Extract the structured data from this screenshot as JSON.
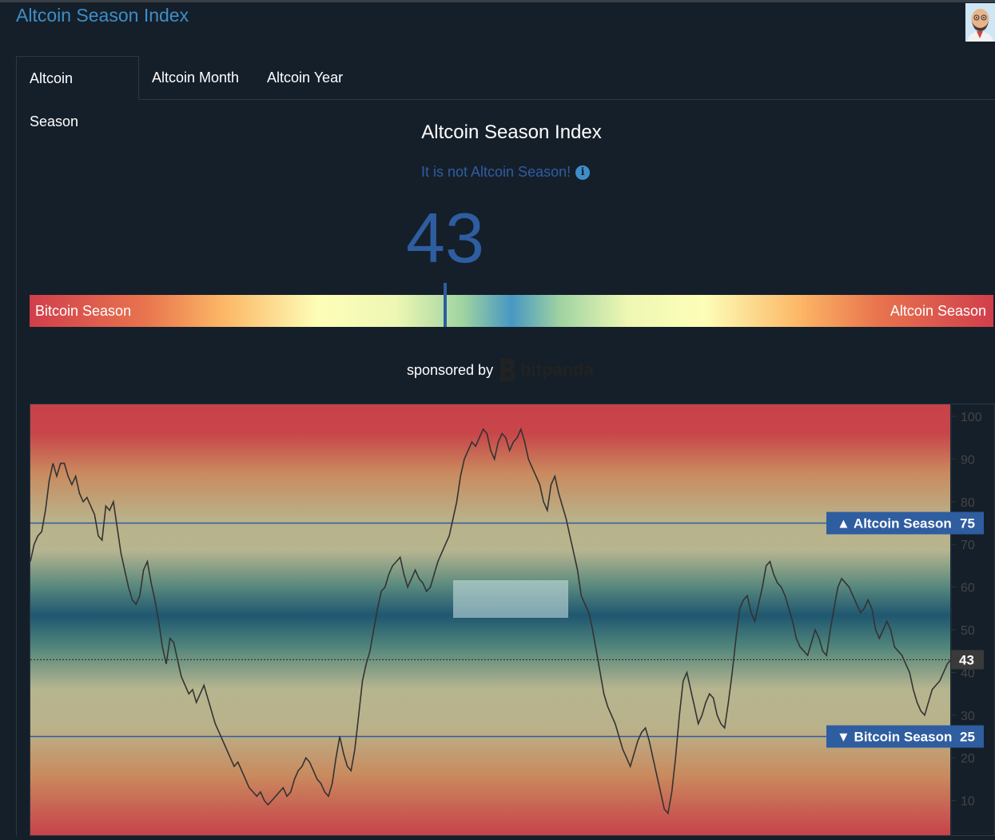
{
  "header": {
    "title": "Altcoin Season Index"
  },
  "tabs": [
    {
      "label": "Altcoin Season",
      "active": true
    },
    {
      "label": "Altcoin Month",
      "active": false
    },
    {
      "label": "Altcoin Year",
      "active": false
    }
  ],
  "index": {
    "title": "Altcoin Season Index",
    "status": "It is not Altcoin Season!",
    "value": "43"
  },
  "gauge": {
    "left_label": "Bitcoin Season",
    "right_label": "Altcoin Season",
    "value_fraction": 0.43
  },
  "sponsor": {
    "text": "sponsored by",
    "brand": "bitpanda"
  },
  "colors": {
    "accent": "#3d8ec8",
    "value_blue": "#2e5da0",
    "bitcoin_red": "#d13e4c",
    "badge_blue": "#2e5da0",
    "current_badge": "#3a3a3a"
  },
  "chart_data": {
    "type": "line",
    "ylim": [
      0,
      100
    ],
    "y_ticks": [
      10,
      20,
      30,
      40,
      50,
      60,
      70,
      80,
      90,
      100
    ],
    "current_value": 43,
    "current_label": "43",
    "thresholds": [
      {
        "label": "▲ Altcoin Season",
        "value": 75,
        "value_label": "75"
      },
      {
        "label": "▼ Bitcoin Season",
        "value": 25,
        "value_label": "25"
      }
    ],
    "values": [
      66,
      70,
      72,
      73,
      78,
      85,
      89,
      86,
      89,
      89,
      86,
      84,
      86,
      82,
      80,
      81,
      79,
      77,
      72,
      71,
      79,
      78,
      80,
      74,
      68,
      64,
      60,
      57,
      56,
      58,
      64,
      66,
      61,
      57,
      52,
      46,
      42,
      48,
      47,
      43,
      39,
      37,
      35,
      36,
      33,
      35,
      37,
      34,
      31,
      28,
      26,
      24,
      22,
      20,
      18,
      19,
      17,
      15,
      13,
      12,
      11,
      12,
      10,
      9,
      10,
      11,
      12,
      13,
      11,
      12,
      15,
      17,
      18,
      20,
      19,
      17,
      15,
      14,
      12,
      11,
      14,
      20,
      25,
      21,
      18,
      17,
      22,
      30,
      38,
      42,
      45,
      50,
      55,
      59,
      60,
      63,
      65,
      66,
      67,
      63,
      60,
      62,
      64,
      62,
      61,
      59,
      60,
      63,
      66,
      68,
      70,
      72,
      76,
      80,
      86,
      90,
      92,
      94,
      93,
      95,
      97,
      96,
      92,
      90,
      94,
      96,
      95,
      92,
      94,
      95,
      97,
      94,
      90,
      88,
      86,
      84,
      80,
      78,
      84,
      86,
      82,
      79,
      76,
      72,
      68,
      64,
      58,
      56,
      54,
      50,
      45,
      40,
      35,
      32,
      30,
      28,
      25,
      22,
      20,
      18,
      21,
      24,
      26,
      27,
      24,
      20,
      16,
      12,
      8,
      7,
      12,
      20,
      30,
      38,
      40,
      36,
      32,
      28,
      30,
      33,
      35,
      34,
      30,
      28,
      27,
      33,
      40,
      48,
      55,
      57,
      58,
      54,
      52,
      56,
      60,
      65,
      66,
      63,
      61,
      60,
      58,
      55,
      52,
      48,
      46,
      45,
      44,
      47,
      50,
      48,
      45,
      44,
      50,
      55,
      60,
      62,
      61,
      60,
      58,
      56,
      54,
      55,
      57,
      55,
      50,
      48,
      50,
      52,
      50,
      46,
      45,
      44,
      42,
      40,
      36,
      33,
      31,
      30,
      33,
      36,
      37,
      38,
      40,
      42,
      43
    ]
  }
}
